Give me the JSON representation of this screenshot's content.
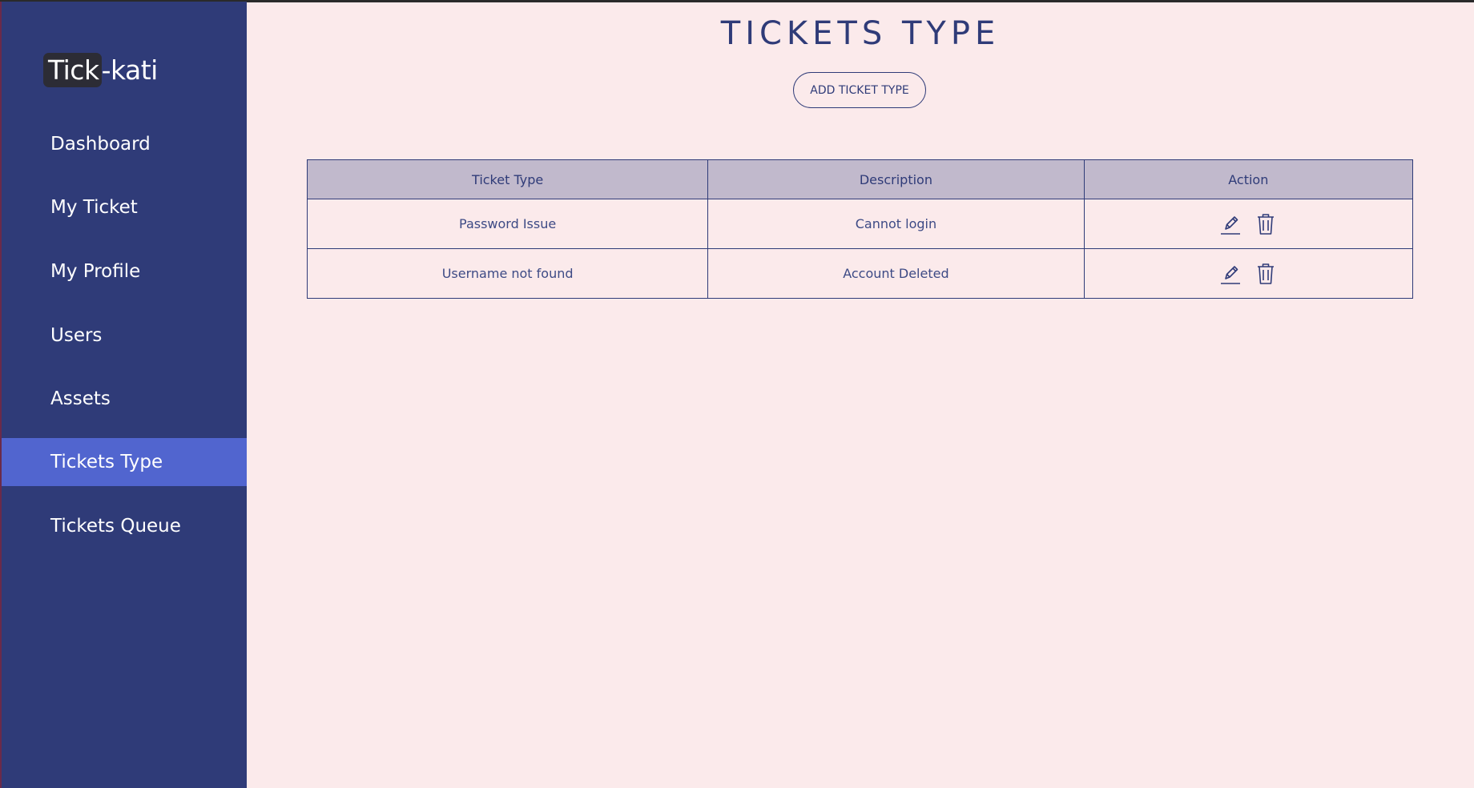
{
  "sidebar": {
    "logo": {
      "highlighted": "Tick",
      "rest": "-kati"
    },
    "items": [
      {
        "label": "Dashboard"
      },
      {
        "label": "My Ticket"
      },
      {
        "label": "My Profile"
      },
      {
        "label": "Users"
      },
      {
        "label": "Assets"
      },
      {
        "label": "Tickets Type",
        "active": true
      },
      {
        "label": "Tickets Queue"
      }
    ]
  },
  "main": {
    "title": "TICKETS TYPE",
    "add_button_label": "ADD TICKET TYPE",
    "table": {
      "headers": [
        "Ticket Type",
        "Description",
        "Action"
      ],
      "rows": [
        {
          "ticket_type": "Password Issue",
          "description": "Cannot login",
          "actions": [
            "edit-icon",
            "trash-icon"
          ]
        },
        {
          "ticket_type": "Username not found",
          "description": "Account Deleted",
          "actions": [
            "edit-icon",
            "trash-icon"
          ]
        }
      ]
    }
  },
  "colors": {
    "sidebar_bg": "#2f3b78",
    "active_item_bg": "#5165cf",
    "page_bg": "#fbeaeb",
    "table_header_bg": "#c1b9cc",
    "accent": "#2f3b78"
  }
}
